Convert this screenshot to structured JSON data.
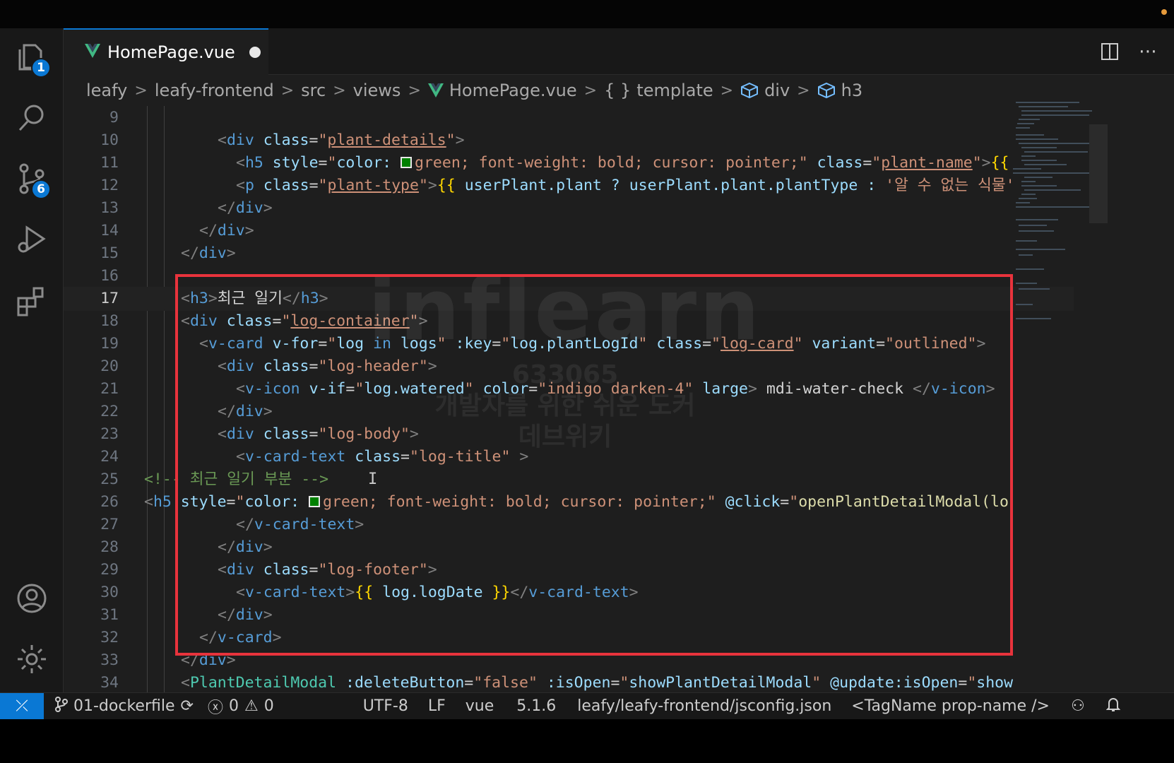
{
  "window": {
    "accent": "#0a78d4",
    "highlight_color": "#e8333c"
  },
  "activity": {
    "explorer_badge": "1",
    "source_control_badge": "6"
  },
  "tab": {
    "filename": "HomePage.vue"
  },
  "breadcrumbs": [
    "leafy",
    "leafy-frontend",
    "src",
    "views",
    "HomePage.vue",
    "template",
    "div",
    "h3"
  ],
  "editor": {
    "lines": [
      "9",
      "10",
      "11",
      "12",
      "13",
      "14",
      "15",
      "16",
      "17",
      "18",
      "19",
      "20",
      "21",
      "22",
      "23",
      "24",
      "25",
      "26",
      "27",
      "28",
      "29",
      "30",
      "31",
      "32",
      "33",
      "34"
    ],
    "current_line": "17",
    "code": {
      "l10_tag": "div",
      "l10_attr": "class",
      "l10_val": "plant-details",
      "l11_tag": "h5",
      "l11_attr": "style",
      "l11_style_a": "color: ",
      "l11_style_b": "green; font-weight: bold; cursor: pointer;",
      "l11_attr2": "class",
      "l11_val2": "plant-name",
      "l11_tail": "{{",
      "l12_tag": "p",
      "l12_attr": "class",
      "l12_val": "plant-type",
      "l12_expr": "userPlant.plant ? userPlant.plant.plantType : ",
      "l12_str": "'알 수 없는 식물'",
      "l13": "div",
      "l14": "div",
      "l15": "div",
      "l17_open": "h3",
      "l17_text": "최근 일기",
      "l17_close": "h3",
      "l18_tag": "div",
      "l18_attr": "class",
      "l18_val": "log-container",
      "l19_tag": "v-card",
      "l19_a1": "v-for",
      "l19_v1a": "log",
      "l19_v1b": "in",
      "l19_v1c": "logs",
      "l19_a2": ":key",
      "l19_v2": "log.plantLogId",
      "l19_a3": "class",
      "l19_v3": "log-card",
      "l19_a4": "variant",
      "l19_v4": "outlined",
      "l20_tag": "div",
      "l20_attr": "class",
      "l20_val": "log-header",
      "l21_tag": "v-icon",
      "l21_a1": "v-if",
      "l21_v1": "log.watered",
      "l21_a2": "color",
      "l21_v2": "indigo darken-4",
      "l21_a3": "large",
      "l21_text": " mdi-water-check ",
      "l21_close": "v-icon",
      "l22": "div",
      "l23_tag": "div",
      "l23_attr": "class",
      "l23_val": "log-body",
      "l24_tag": "v-card-text",
      "l24_attr": "class",
      "l24_val": "log-title",
      "l25_comment": "<!-- 최근 일기 부분 -->",
      "l26_tag": "h5",
      "l26_attr": "style",
      "l26_style_a": "color: ",
      "l26_style_b": "green; font-weight: bold; cursor: pointer;",
      "l26_attr2": "@click",
      "l26_val2": "openPlantDetailModal(lo",
      "l27": "v-card-text",
      "l28": "div",
      "l29_tag": "div",
      "l29_attr": "class",
      "l29_val": "log-footer",
      "l30_tag": "v-card-text",
      "l30_expr": "log.logDate",
      "l30_close": "v-card-text",
      "l31": "div",
      "l32": "v-card",
      "l33": "div",
      "l34_tag": "PlantDetailModal",
      "l34_a1": ":deleteButton",
      "l34_v1": "false",
      "l34_a2": ":isOpen",
      "l34_v2": "showPlantDetailModal",
      "l34_a3": "@update:isOpen",
      "l34_v3": "show"
    }
  },
  "watermark": {
    "logo": "inflearn",
    "id": "633065",
    "line1": "개발자를 위한 쉬운 도커",
    "line2": "데브위키"
  },
  "status": {
    "branch": "01-dockerfile",
    "errors": "0",
    "warnings": "0",
    "encoding": "UTF-8",
    "eol": "LF",
    "language": "vue",
    "version": "5.1.6",
    "config": "leafy/leafy-frontend/jsconfig.json",
    "snippet": "<TagName prop-name />"
  }
}
